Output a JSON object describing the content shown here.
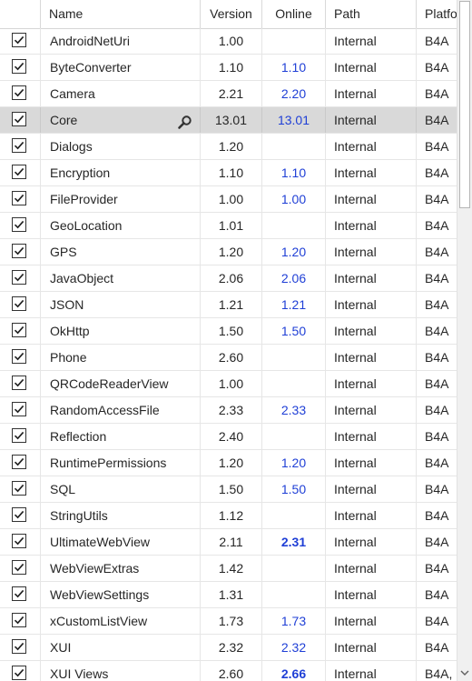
{
  "columns": {
    "name": "Name",
    "version": "Version",
    "online": "Online",
    "path": "Path",
    "platform": "Platfo"
  },
  "colors": {
    "online_text": "#1f3fd6",
    "selected_row": "#d9d9d9"
  },
  "rows": [
    {
      "name": "AndroidNetUri",
      "version": "1.00",
      "online": "",
      "online_bold": false,
      "path": "Internal",
      "platform": "B4A",
      "checked": true
    },
    {
      "name": "ByteConverter",
      "version": "1.10",
      "online": "1.10",
      "online_bold": false,
      "path": "Internal",
      "platform": "B4A",
      "checked": true
    },
    {
      "name": "Camera",
      "version": "2.21",
      "online": "2.20",
      "online_bold": false,
      "path": "Internal",
      "platform": "B4A",
      "checked": true
    },
    {
      "name": "Core",
      "version": "13.01",
      "online": "13.01",
      "online_bold": false,
      "path": "Internal",
      "platform": "B4A",
      "checked": true,
      "selected": true,
      "icon": "search-icon"
    },
    {
      "name": "Dialogs",
      "version": "1.20",
      "online": "",
      "online_bold": false,
      "path": "Internal",
      "platform": "B4A",
      "checked": true
    },
    {
      "name": "Encryption",
      "version": "1.10",
      "online": "1.10",
      "online_bold": false,
      "path": "Internal",
      "platform": "B4A",
      "checked": true
    },
    {
      "name": "FileProvider",
      "version": "1.00",
      "online": "1.00",
      "online_bold": false,
      "path": "Internal",
      "platform": "B4A",
      "checked": true
    },
    {
      "name": "GeoLocation",
      "version": "1.01",
      "online": "",
      "online_bold": false,
      "path": "Internal",
      "platform": "B4A",
      "checked": true
    },
    {
      "name": "GPS",
      "version": "1.20",
      "online": "1.20",
      "online_bold": false,
      "path": "Internal",
      "platform": "B4A",
      "checked": true
    },
    {
      "name": "JavaObject",
      "version": "2.06",
      "online": "2.06",
      "online_bold": false,
      "path": "Internal",
      "platform": "B4A",
      "checked": true
    },
    {
      "name": "JSON",
      "version": "1.21",
      "online": "1.21",
      "online_bold": false,
      "path": "Internal",
      "platform": "B4A",
      "checked": true
    },
    {
      "name": "OkHttp",
      "version": "1.50",
      "online": "1.50",
      "online_bold": false,
      "path": "Internal",
      "platform": "B4A",
      "checked": true
    },
    {
      "name": "Phone",
      "version": "2.60",
      "online": "",
      "online_bold": false,
      "path": "Internal",
      "platform": "B4A",
      "checked": true
    },
    {
      "name": "QRCodeReaderView",
      "version": "1.00",
      "online": "",
      "online_bold": false,
      "path": "Internal",
      "platform": "B4A",
      "checked": true
    },
    {
      "name": "RandomAccessFile",
      "version": "2.33",
      "online": "2.33",
      "online_bold": false,
      "path": "Internal",
      "platform": "B4A",
      "checked": true
    },
    {
      "name": "Reflection",
      "version": "2.40",
      "online": "",
      "online_bold": false,
      "path": "Internal",
      "platform": "B4A",
      "checked": true
    },
    {
      "name": "RuntimePermissions",
      "version": "1.20",
      "online": "1.20",
      "online_bold": false,
      "path": "Internal",
      "platform": "B4A",
      "checked": true
    },
    {
      "name": "SQL",
      "version": "1.50",
      "online": "1.50",
      "online_bold": false,
      "path": "Internal",
      "platform": "B4A",
      "checked": true
    },
    {
      "name": "StringUtils",
      "version": "1.12",
      "online": "",
      "online_bold": false,
      "path": "Internal",
      "platform": "B4A",
      "checked": true
    },
    {
      "name": "UltimateWebView",
      "version": "2.11",
      "online": "2.31",
      "online_bold": true,
      "path": "Internal",
      "platform": "B4A",
      "checked": true
    },
    {
      "name": "WebViewExtras",
      "version": "1.42",
      "online": "",
      "online_bold": false,
      "path": "Internal",
      "platform": "B4A",
      "checked": true
    },
    {
      "name": "WebViewSettings",
      "version": "1.31",
      "online": "",
      "online_bold": false,
      "path": "Internal",
      "platform": "B4A",
      "checked": true
    },
    {
      "name": "xCustomListView",
      "version": "1.73",
      "online": "1.73",
      "online_bold": false,
      "path": "Internal",
      "platform": "B4A",
      "checked": true
    },
    {
      "name": "XUI",
      "version": "2.32",
      "online": "2.32",
      "online_bold": false,
      "path": "Internal",
      "platform": "B4A",
      "checked": true
    },
    {
      "name": "XUI Views",
      "version": "2.60",
      "online": "2.66",
      "online_bold": true,
      "path": "Internal",
      "platform": "B4A,",
      "checked": true
    }
  ]
}
